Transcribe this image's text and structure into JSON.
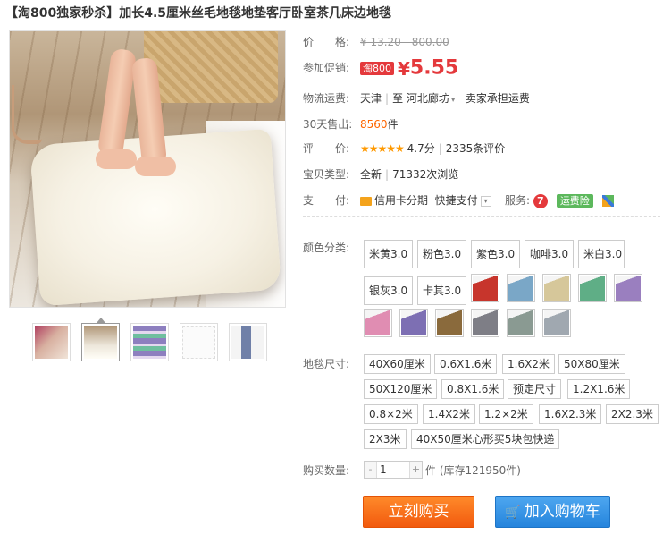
{
  "title": "【淘800独家秒杀】加长4.5厘米丝毛地毯地垫客厅卧室茶几床边地毯",
  "thumbnails": [
    "t1",
    "t2",
    "t3",
    "t4",
    "t5"
  ],
  "price": {
    "label": "价　　格:",
    "original": "¥ 13.20 - 800.00"
  },
  "promo": {
    "label": "参加促销:",
    "tag": "淘800",
    "yen": "¥",
    "price": "5.55"
  },
  "shipping": {
    "label": "物流运费:",
    "from": "天津",
    "sep": "|",
    "to_prefix": "至",
    "to": "河北廊坊",
    "fee": "卖家承担运费"
  },
  "sold": {
    "label": "30天售出:",
    "count": "8560",
    "unit": "件"
  },
  "rating": {
    "label": "评　　价:",
    "stars": "★★★★★",
    "score": "4.7分",
    "sep": "|",
    "reviews": "2335条评价"
  },
  "type": {
    "label": "宝贝类型:",
    "condition": "全新",
    "sep": "|",
    "views": "71332次浏览"
  },
  "payment": {
    "label": "支　　付:",
    "credit": "信用卡分期",
    "quick": "快捷支付",
    "service_label": "服务:",
    "service_7": "7",
    "insurance": "运费险"
  },
  "color": {
    "label": "颜色分类:",
    "options": [
      "米黄3.0",
      "粉色3.0",
      "紫色3.0",
      "咖啡3.0",
      "米白3.0",
      "银灰3.0",
      "卡其3.0"
    ],
    "swatches": [
      "#c7352c",
      "#7aa7c7",
      "#d6c79a",
      "#5fae86",
      "#9a7fbf",
      "#e08db2",
      "#7d6fb3",
      "#8a6a3c",
      "#7e7e86",
      "#8a9a92",
      "#a0a8b0"
    ]
  },
  "size": {
    "label": "地毯尺寸:",
    "options": [
      "40X60厘米",
      "0.6X1.6米",
      "1.6X2米",
      "50X80厘米",
      "50X120厘米",
      "0.8X1.6米",
      "预定尺寸",
      "1.2X1.6米",
      "0.8×2米",
      "1.4X2米",
      "1.2×2米",
      "1.6X2.3米",
      "2X2.3米",
      "2X3米",
      "40X50厘米心形买5块包快递"
    ]
  },
  "quantity": {
    "label": "购买数量:",
    "value": "1",
    "minus": "-",
    "plus": "+",
    "stock": "件 (库存121950件)"
  },
  "actions": {
    "buy": "立刻购买",
    "cart": "加入购物车",
    "cart_icon": "🛒"
  }
}
